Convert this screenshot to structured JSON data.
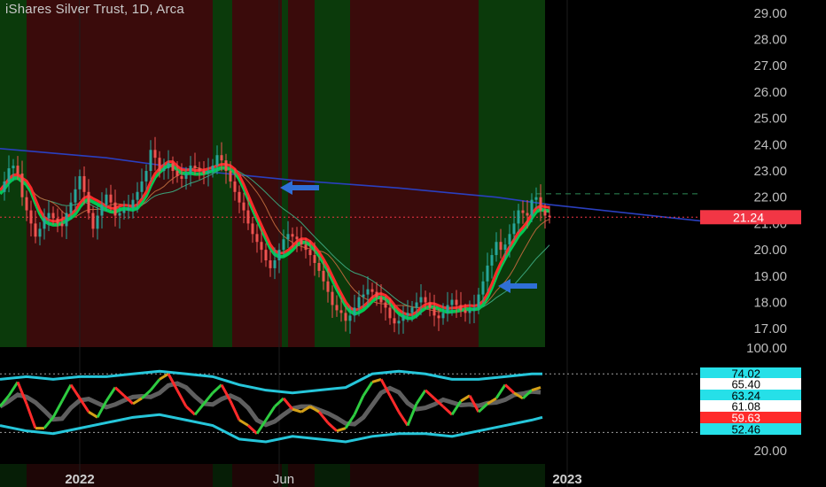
{
  "header": {
    "title": "iShares Silver Trust, 1D, Arca"
  },
  "colors": {
    "background": "#000000",
    "bull_zone": "#0b3a0b",
    "bear_zone": "#3a0b0b",
    "up_candle": "#26a69a",
    "down_candle": "#ef5350",
    "ribbon_red": "#ff2a2a",
    "ribbon_green": "#00c853",
    "ma_long": "#2a3fbf",
    "osc_band": "#26c6da",
    "price_badge": "#f23645"
  },
  "chart_data": [
    {
      "type": "candlestick",
      "title": "iShares Silver Trust, 1D, Arca",
      "ylim": [
        16.3,
        29.5
      ],
      "y_ticks": [
        "29.00",
        "28.00",
        "27.00",
        "26.00",
        "25.00",
        "24.00",
        "23.00",
        "22.00",
        "21.00",
        "20.00",
        "19.00",
        "18.00",
        "17.00"
      ],
      "x_labels": [
        "2022",
        "Jun",
        "2023"
      ],
      "last_price": "21.24",
      "upper_dashed_level": 22.13,
      "series": [
        {
          "name": "close",
          "x": [
            0,
            5,
            10,
            15,
            20,
            25,
            30,
            35,
            40,
            45,
            50,
            55,
            60,
            65,
            70,
            75,
            80,
            85,
            90,
            95,
            100,
            105,
            110,
            115,
            120,
            125,
            130,
            135,
            140,
            145,
            150,
            155,
            160,
            165,
            170,
            175,
            180,
            185,
            190,
            195,
            200,
            205,
            210,
            215,
            220,
            225,
            230,
            235,
            240,
            245,
            250,
            255,
            260,
            265,
            270,
            275,
            280,
            285,
            290,
            295,
            300,
            305,
            310,
            315,
            320,
            325,
            330,
            335,
            340,
            345,
            350,
            355,
            360,
            365,
            370,
            375,
            380,
            385,
            390,
            395,
            400,
            405,
            410,
            415,
            420,
            425,
            430,
            435,
            440,
            445,
            450,
            455,
            460,
            465,
            470,
            475,
            480,
            485,
            490,
            495,
            500,
            505,
            510,
            515,
            520,
            525,
            530,
            535,
            540,
            545,
            550,
            555,
            560,
            565,
            570,
            575,
            580,
            585,
            590,
            595,
            600,
            605,
            610,
            615,
            620
          ],
          "values": [
            22.2,
            22.6,
            23.1,
            23.2,
            22.9,
            22.0,
            21.5,
            21.0,
            20.5,
            20.8,
            21.2,
            21.4,
            21.2,
            21.0,
            20.9,
            21.4,
            21.8,
            22.3,
            22.8,
            22.2,
            21.4,
            20.8,
            21.3,
            21.7,
            22.1,
            21.8,
            21.3,
            21.4,
            21.5,
            21.6,
            21.9,
            22.2,
            22.6,
            23.0,
            23.8,
            23.5,
            23.0,
            23.1,
            23.3,
            23.0,
            22.8,
            22.7,
            22.9,
            23.2,
            23.1,
            23.0,
            22.9,
            23.0,
            23.2,
            23.6,
            23.4,
            23.0,
            22.6,
            22.2,
            21.8,
            21.5,
            21.0,
            20.6,
            20.3,
            20.0,
            19.6,
            19.3,
            19.6,
            20.0,
            20.4,
            20.6,
            20.5,
            20.4,
            20.2,
            20.0,
            19.8,
            19.5,
            19.2,
            18.8,
            18.4,
            17.9,
            17.7,
            17.6,
            17.3,
            17.5,
            17.8,
            18.2,
            18.3,
            18.5,
            18.4,
            18.2,
            18.0,
            17.8,
            17.4,
            17.2,
            17.3,
            17.5,
            17.6,
            17.8,
            18.0,
            18.2,
            18.0,
            17.8,
            17.5,
            17.4,
            17.6,
            17.9,
            18.1,
            17.9,
            17.7,
            17.6,
            17.7,
            17.8,
            18.3,
            18.8,
            19.4,
            19.8,
            20.3,
            20.0,
            20.2,
            20.6,
            21.0,
            21.5,
            21.4,
            21.3,
            21.9,
            22.0,
            21.5,
            21.3,
            21.25
          ]
        },
        {
          "name": "ma_long",
          "x": [
            0,
            120,
            240,
            330,
            450,
            560,
            620,
            790
          ],
          "values": [
            23.85,
            23.5,
            22.95,
            22.65,
            22.35,
            22.0,
            21.72,
            21.1
          ]
        }
      ]
    },
    {
      "type": "line",
      "title": "",
      "ylim": [
        48,
        78
      ],
      "y_ticks": [
        "100.00",
        "20.00"
      ],
      "badges": [
        {
          "text": "74.02",
          "bg": "#26e0e8",
          "fg": "#000000"
        },
        {
          "text": "65.40",
          "bg": "#ffffff",
          "fg": "#000000"
        },
        {
          "text": "63.24",
          "bg": "#26e0e8",
          "fg": "#000000"
        },
        {
          "text": "61.08",
          "bg": "#ffffff",
          "fg": "#000000"
        },
        {
          "text": "59.63",
          "bg": "#ff2a2a",
          "fg": "#ffffff"
        },
        {
          "text": "52.46",
          "bg": "#26e0e8",
          "fg": "#000000"
        }
      ],
      "series": [
        {
          "name": "osc",
          "x": [
            0,
            10,
            20,
            30,
            40,
            50,
            60,
            70,
            80,
            90,
            100,
            110,
            120,
            130,
            140,
            150,
            160,
            170,
            180,
            190,
            200,
            210,
            220,
            230,
            240,
            250,
            260,
            270,
            280,
            290,
            300,
            310,
            320,
            330,
            340,
            350,
            360,
            370,
            380,
            390,
            400,
            410,
            420,
            430,
            440,
            450,
            460,
            470,
            480,
            490,
            500,
            510,
            520,
            530,
            540,
            550,
            560,
            570,
            580,
            590,
            600,
            610
          ],
          "values": [
            62,
            66,
            71,
            63,
            54,
            54,
            58,
            64,
            70,
            65,
            60,
            58,
            64,
            69,
            66,
            63,
            65,
            68,
            72,
            74,
            68,
            62,
            59,
            63,
            67,
            70,
            64,
            57,
            55,
            52,
            57,
            62,
            65,
            61,
            60,
            62,
            60,
            56,
            53,
            54,
            59,
            66,
            71,
            72,
            66,
            60,
            55,
            63,
            68,
            65,
            62,
            59,
            64,
            66,
            60,
            63,
            65,
            70,
            67,
            65,
            68,
            69
          ]
        },
        {
          "name": "upper_band",
          "x": [
            0,
            30,
            60,
            90,
            120,
            150,
            180,
            210,
            240,
            270,
            300,
            330,
            360,
            390,
            420,
            450,
            480,
            510,
            540,
            570,
            600,
            612
          ],
          "values": [
            72,
            73,
            72,
            73,
            73,
            74,
            75,
            74,
            73,
            70,
            68,
            67,
            68,
            69,
            74,
            75,
            74,
            72,
            72,
            73,
            74,
            74
          ]
        },
        {
          "name": "lower_band",
          "x": [
            0,
            30,
            60,
            90,
            120,
            150,
            180,
            210,
            240,
            270,
            300,
            330,
            360,
            390,
            420,
            450,
            480,
            510,
            540,
            570,
            600,
            612
          ],
          "values": [
            55,
            53,
            52,
            54,
            56,
            58,
            59,
            57,
            55,
            50,
            49,
            51,
            50,
            49,
            51,
            52,
            52,
            51,
            53,
            55,
            57,
            58
          ]
        }
      ]
    }
  ]
}
